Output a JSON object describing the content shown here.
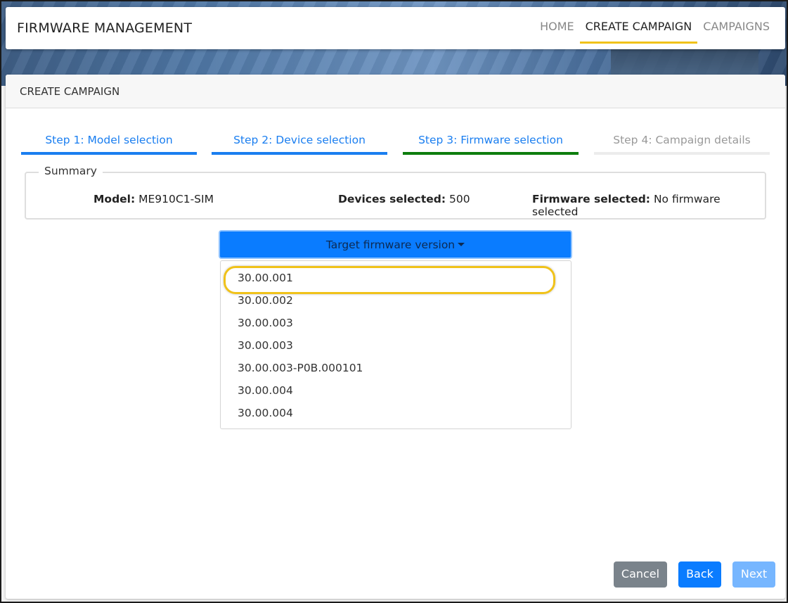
{
  "navbar": {
    "brand": "FIRMWARE MANAGEMENT",
    "links": [
      "HOME",
      "CREATE CAMPAIGN",
      "CAMPAIGNS"
    ],
    "active_link": "CREATE CAMPAIGN"
  },
  "card": {
    "title": "CREATE CAMPAIGN"
  },
  "steps": [
    {
      "label": "Step 1: Model selection",
      "state": "done"
    },
    {
      "label": "Step 2: Device selection",
      "state": "done"
    },
    {
      "label": "Step 3: Firmware selection",
      "state": "current"
    },
    {
      "label": "Step 4: Campaign details",
      "state": "disabled"
    }
  ],
  "summary": {
    "legend": "Summary",
    "model_label": "Model:",
    "model_value": "ME910C1-SIM",
    "devices_label": "Devices selected:",
    "devices_value": "500",
    "firmware_label": "Firmware selected:",
    "firmware_value": "No firmware selected"
  },
  "dropdown": {
    "label": "Target firmware version",
    "items": [
      "30.00.001",
      "30.00.002",
      "30.00.003",
      "30.00.003",
      "30.00.003-P0B.000101",
      "30.00.004",
      "30.00.004"
    ],
    "highlighted_index": 0
  },
  "footer": {
    "cancel_label": "Cancel",
    "back_label": "Back",
    "next_label": "Next"
  },
  "colors": {
    "primary": "#0a7cff",
    "active_step": "#0d7d0d",
    "highlight": "#f0c21a",
    "secondary": "#7a838b"
  }
}
